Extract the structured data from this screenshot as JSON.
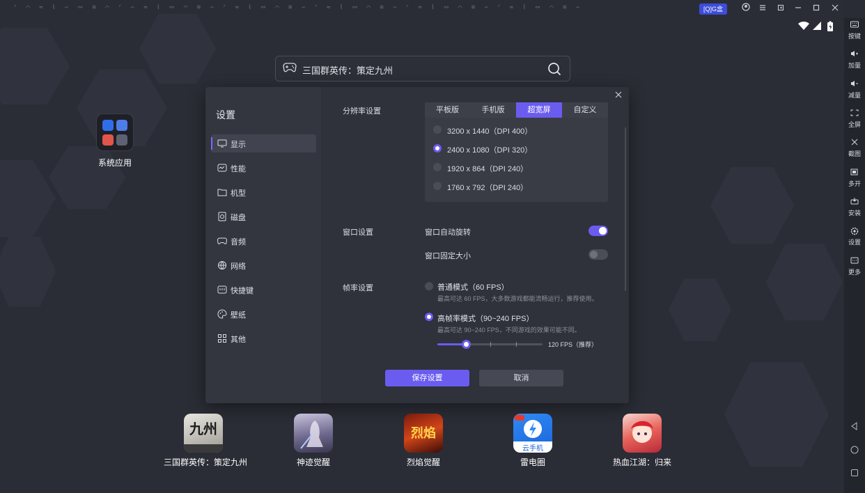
{
  "titlebar": {
    "noise_text": "ᐟ ⌒ ≈ ⌇ ∽ ∾ ≋ ⌒ ᐟ ∽ ≈ ⌇ ∾ ⌒ ≋ ∽ ᐟ ≈ ⌇ ∾ ⌒ ≋ ∽ ᐟ ≈ ⌇ ∾ ⌒ ≋ ∽ ᐟ ≈ ⌇ ∾ ⌒ ≋ ∽ ᐟ ≈ ⌇ ∾ ⌒ ≋ ∽",
    "badge": "[Q]G盒"
  },
  "right_sidebar": {
    "items": [
      {
        "label": "按键",
        "icon": "keyboard-icon"
      },
      {
        "label": "加量",
        "icon": "volume-up-icon"
      },
      {
        "label": "减量",
        "icon": "volume-down-icon"
      },
      {
        "label": "全屏",
        "icon": "fullscreen-icon"
      },
      {
        "label": "截图",
        "icon": "scissors-icon"
      },
      {
        "label": "多开",
        "icon": "multi-instance-icon"
      },
      {
        "label": "安装",
        "icon": "install-icon"
      },
      {
        "label": "设置",
        "icon": "gear-icon"
      },
      {
        "label": "更多",
        "icon": "more-icon"
      }
    ]
  },
  "search": {
    "value": "三国群英传：策定九州"
  },
  "system_apps": {
    "label": "系统应用"
  },
  "settings": {
    "title": "设置",
    "menu": [
      {
        "label": "显示",
        "active": true
      },
      {
        "label": "性能",
        "active": false
      },
      {
        "label": "机型",
        "active": false
      },
      {
        "label": "磁盘",
        "active": false
      },
      {
        "label": "音频",
        "active": false
      },
      {
        "label": "网络",
        "active": false
      },
      {
        "label": "快捷键",
        "active": false
      },
      {
        "label": "壁纸",
        "active": false
      },
      {
        "label": "其他",
        "active": false
      }
    ],
    "resolution": {
      "label": "分辨率设置",
      "tabs": [
        "平板版",
        "手机版",
        "超宽屏",
        "自定义"
      ],
      "active_tab": "超宽屏",
      "options": [
        {
          "label": "3200 x 1440（DPI 400）",
          "selected": false
        },
        {
          "label": "2400 x 1080（DPI 320）",
          "selected": true
        },
        {
          "label": "1920 x 864（DPI 240）",
          "selected": false
        },
        {
          "label": "1760 x 792（DPI 240）",
          "selected": false
        }
      ]
    },
    "window": {
      "label": "窗口设置",
      "auto_rotate": {
        "label": "窗口自动旋转",
        "on": true
      },
      "fixed_size": {
        "label": "窗口固定大小",
        "on": false
      }
    },
    "framerate": {
      "label": "帧率设置",
      "normal": {
        "title": "普通模式（60 FPS）",
        "desc": "最高可达 60 FPS，大多数游戏都能流畅运行，推荐使用。",
        "selected": false
      },
      "high": {
        "title": "高帧率模式（90~240 FPS）",
        "desc": "最高可达 90~240 FPS，不同游戏的效果可能不同。",
        "selected": true
      },
      "slider_value": "120 FPS（推荐）",
      "slider_fraction": 0.27
    },
    "save_label": "保存设置",
    "cancel_label": "取消"
  },
  "dock": [
    {
      "label": "三国群英传：策定九州",
      "tile_text": "九州"
    },
    {
      "label": "神迹觉醒",
      "tile_text": ""
    },
    {
      "label": "烈焰觉醒",
      "tile_text": "烈焰"
    },
    {
      "label": "雷电圈",
      "tile_text": "云手机"
    },
    {
      "label": "热血江湖：归来",
      "tile_text": ""
    }
  ],
  "colors": {
    "accent": "#6b5cf0",
    "background": "#2b2d36",
    "dialog": "#2f313b"
  }
}
